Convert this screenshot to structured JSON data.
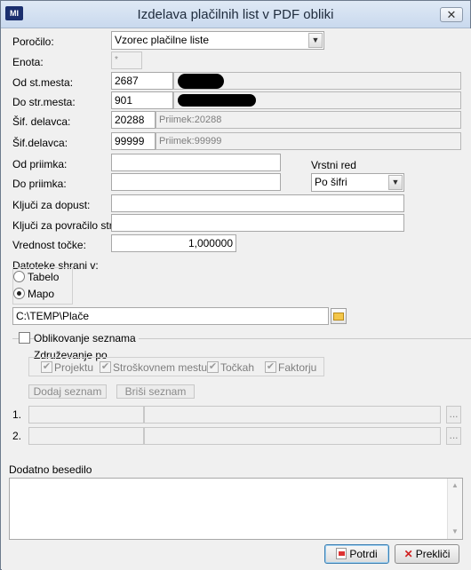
{
  "window": {
    "title": "Izdelava plačilnih list v PDF obliki",
    "app_icon_text": "MI",
    "close_glyph": "✕"
  },
  "form": {
    "porocilo": {
      "label": "Poročilo:",
      "value": "Vzorec plačilne liste"
    },
    "enota": {
      "label": "Enota:",
      "value": "*"
    },
    "od_st_mesta": {
      "label": "Od st.mesta:",
      "value": "2687"
    },
    "do_str_mesta": {
      "label": "Do str.mesta:",
      "value": "901"
    },
    "sif_delavca_1": {
      "label": "Šif. delavca:",
      "value": "20288",
      "description": "Priimek:20288"
    },
    "sif_delavca_2": {
      "label": "Šif.delavca:",
      "value": "99999",
      "description": "Priimek:99999"
    },
    "od_priimka": {
      "label": "Od priimka:",
      "value": ""
    },
    "do_priimka": {
      "label": "Do priimka:",
      "value": ""
    },
    "vrstni_red": {
      "label": "Vrstni red",
      "value": "Po šifri"
    },
    "kljuci_dopust": {
      "label": "Ključi za dopust:",
      "value": ""
    },
    "kljuci_povracilo": {
      "label": "Ključi za povračilo str.:",
      "value": ""
    },
    "vrednost_tocke": {
      "label": "Vrednost točke:",
      "value": "1,000000"
    },
    "datoteke": {
      "label": "Datoteke shrani v:",
      "options": [
        {
          "label": "Tabelo",
          "selected": false
        },
        {
          "label": "Mapo",
          "selected": true
        }
      ]
    },
    "path": {
      "value": "C:\\TEMP\\Plače"
    }
  },
  "oblikovanje": {
    "label": "Oblikovanje seznama",
    "checked": false,
    "zdruzevanje_label": "Združevanje po",
    "checkboxes": [
      {
        "label": "Projektu",
        "checked": true
      },
      {
        "label": "Stroškovnem mestu",
        "checked": true
      },
      {
        "label": "Točkah",
        "checked": true
      },
      {
        "label": "Faktorju",
        "checked": true
      }
    ],
    "add_label": "Dodaj seznam",
    "delete_label": "Briši seznam",
    "rows": [
      {
        "num": "1.",
        "browse": "..."
      },
      {
        "num": "2.",
        "browse": "..."
      }
    ]
  },
  "dodatno": {
    "label": "Dodatno besedilo",
    "value": ""
  },
  "buttons": {
    "ok": "Potrdi",
    "cancel": "Prekliči"
  },
  "icons": {
    "dropdown": "▼",
    "check": "✔",
    "scroll_up": "▲",
    "scroll_down": "▼",
    "cancel_x": "✕"
  }
}
